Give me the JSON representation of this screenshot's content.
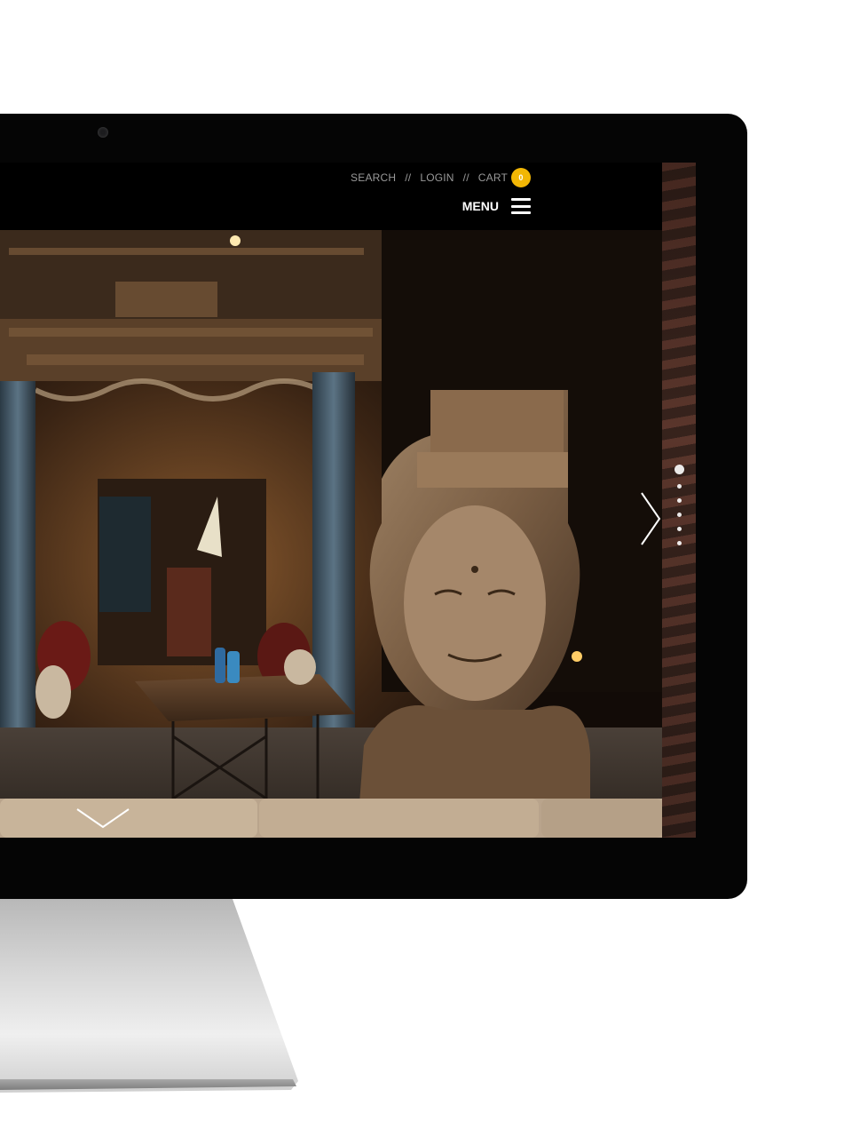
{
  "header": {
    "utility_nav": {
      "search": "SEARCH",
      "separator": "//",
      "login": "LOGIN",
      "cart": "CART",
      "cart_count": "0"
    },
    "menu_label": "MENU"
  },
  "hero": {
    "slide_count": 6,
    "active_slide": 1,
    "icons": [
      "chevron-right-icon",
      "chevron-down-icon",
      "hamburger-menu-icon"
    ]
  },
  "colors": {
    "badge": "#f2b705",
    "bezel": "#050505",
    "topbar": "#000000"
  }
}
